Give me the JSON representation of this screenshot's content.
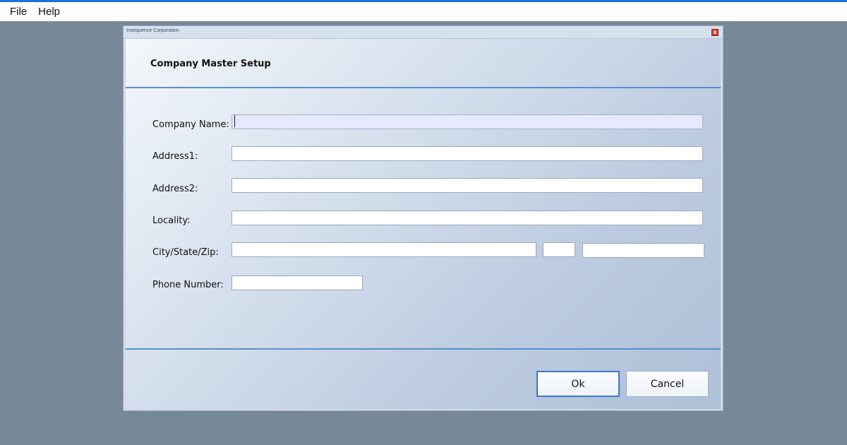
{
  "menubar": {
    "items": [
      {
        "label": "File"
      },
      {
        "label": "Help"
      }
    ]
  },
  "dialog": {
    "window_title": "Insequence Corporation",
    "close_glyph": "x",
    "header_title": "Company Master Setup",
    "fields": {
      "company_name": {
        "label": "Company Name:",
        "value": ""
      },
      "address1": {
        "label": "Address1:",
        "value": ""
      },
      "address2": {
        "label": "Address2:",
        "value": ""
      },
      "locality": {
        "label": "Locality:",
        "value": ""
      },
      "city_state_zip": {
        "label": "City/State/Zip:",
        "city": "",
        "state": "",
        "zip": ""
      },
      "phone_number": {
        "label": "Phone Number:",
        "value": ""
      }
    },
    "buttons": {
      "ok": "Ok",
      "cancel": "Cancel"
    }
  },
  "colors": {
    "desktop": "#778899",
    "accent": "#1a73d9",
    "divider": "#5a8fc9",
    "focused_field": "#e6e8fb",
    "close_button": "#d9352f"
  }
}
